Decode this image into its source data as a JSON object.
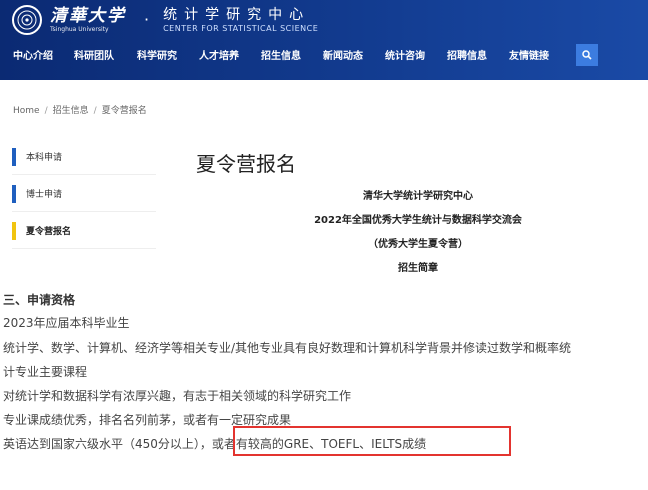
{
  "header": {
    "university_cn": "清華大学",
    "university_en": "Tsinghua University",
    "separator": "·",
    "center_cn": "统计学研究中心",
    "center_en": "CENTER FOR STATISTICAL SCIENCE",
    "colors": {
      "header_bg": "#0d2f7a",
      "search_bg": "#3c7ce0"
    }
  },
  "nav": {
    "items": [
      {
        "label": "中心介绍"
      },
      {
        "label": "科研团队"
      },
      {
        "label": "科学研究"
      },
      {
        "label": "人才培养"
      },
      {
        "label": "招生信息"
      },
      {
        "label": "新闻动态"
      },
      {
        "label": "统计咨询"
      },
      {
        "label": "招聘信息"
      },
      {
        "label": "友情链接"
      }
    ],
    "search_icon": "search-icon"
  },
  "breadcrumb": {
    "home": "Home",
    "level1": "招生信息",
    "current": "夏令营报名",
    "separator": "/"
  },
  "sidebar": {
    "items": [
      {
        "label": "本科申请",
        "active": false
      },
      {
        "label": "博士申请",
        "active": false
      },
      {
        "label": "夏令营报名",
        "active": true
      }
    ],
    "colors": {
      "bar": "#1f5fbf",
      "active_bar": "#f1c40f"
    }
  },
  "main": {
    "title": "夏令营报名",
    "notice_lines": [
      "清华大学统计学研究中心",
      "2022年全国优秀大学生统计与数据科学交流会",
      "（优秀大学生夏令营）",
      "招生简章"
    ],
    "section_title": "三、申请资格",
    "body_lines": [
      "2023年应届本科毕业生",
      "统计学、数学、计算机、经济学等相关专业/其他专业具有良好数理和计算机科学背景并修读过数学和概率统",
      "计专业主要课程",
      "对统计学和数据科学有浓厚兴趣，有志于相关领域的科学研究工作",
      "专业课成绩优秀，排名名列前茅，或者有一定研究成果",
      "英语达到国家六级水平（450分以上），或者有较高的GRE、TOEFL、IELTS成绩"
    ],
    "highlight_color": "#e3342f"
  }
}
